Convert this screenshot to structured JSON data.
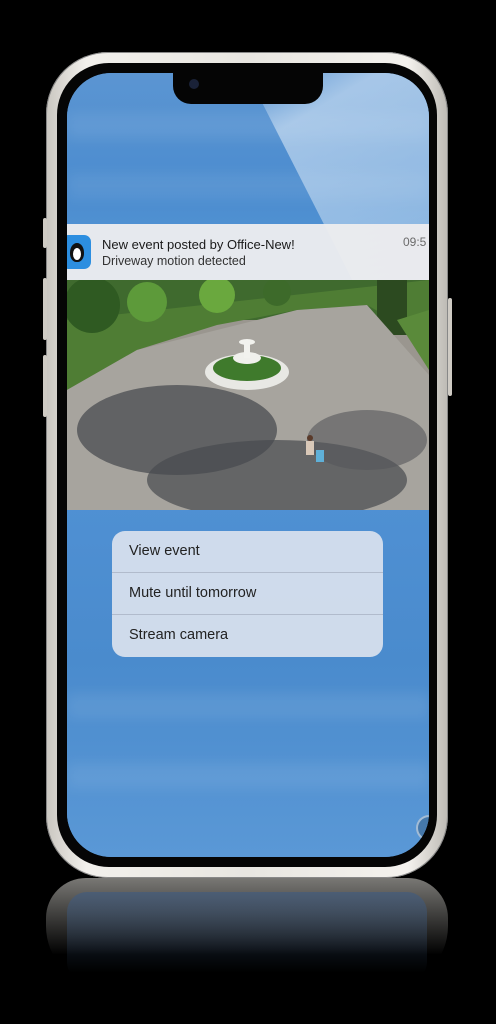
{
  "notification": {
    "icon": "penguin-app-icon",
    "title": "New event posted by Office-New!",
    "subtitle": "Driveway motion detected",
    "time": "09:5"
  },
  "snapshot": {
    "description_icon": "camera-snapshot"
  },
  "menu": {
    "items": [
      {
        "label": "View event"
      },
      {
        "label": "Mute until tomorrow"
      },
      {
        "label": "Stream camera"
      }
    ]
  },
  "colors": {
    "background": "#000000",
    "screen_blue": "#4f8fd0",
    "banner": "#ececee",
    "app_icon": "#2c8ee0"
  }
}
